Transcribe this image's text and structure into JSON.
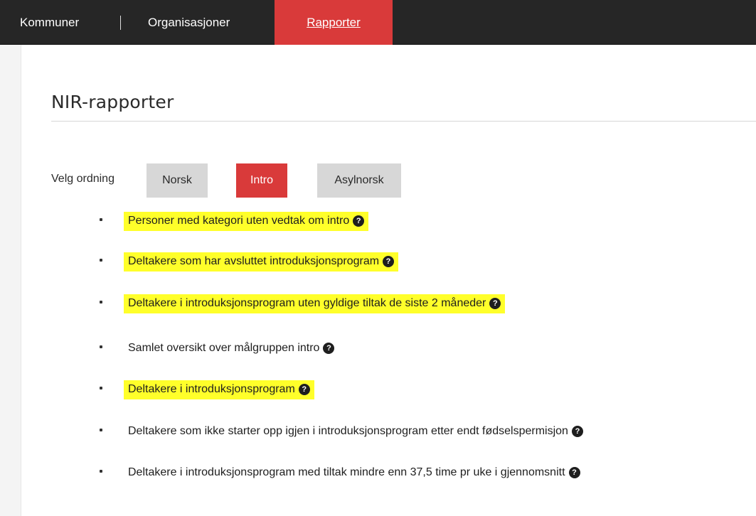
{
  "nav": {
    "items": [
      {
        "label": "Kommuner"
      },
      {
        "label": "Organisasjoner"
      },
      {
        "label": "Rapporter",
        "active": true
      }
    ],
    "active_color": "#d93a3a",
    "background": "#262626"
  },
  "page": {
    "title": "NIR-rapporter"
  },
  "scheme": {
    "label": "Velg ordning",
    "options": [
      {
        "label": "Norsk",
        "selected": false
      },
      {
        "label": "Intro",
        "selected": true
      },
      {
        "label": "Asylnorsk",
        "selected": false
      }
    ]
  },
  "reports": [
    {
      "label": "Personer med kategori uten vedtak om intro",
      "highlighted": true,
      "icon": "question-circle-icon"
    },
    {
      "label": "Deltakere som har avsluttet introduksjonsprogram",
      "highlighted": true,
      "icon": "question-circle-icon"
    },
    {
      "label": "Deltakere i introduksjonsprogram uten gyldige tiltak de siste 2 måneder",
      "highlighted": true,
      "icon": "question-circle-icon"
    },
    {
      "label": "Samlet oversikt over målgruppen intro",
      "highlighted": false,
      "icon": "question-circle-icon"
    },
    {
      "label": "Deltakere i introduksjonsprogram",
      "highlighted": true,
      "icon": "question-circle-icon"
    },
    {
      "label": "Deltakere som ikke starter opp igjen i introduksjonsprogram etter endt fødselspermisjon",
      "highlighted": false,
      "icon": "question-circle-icon"
    },
    {
      "label": "Deltakere i introduksjonsprogram med tiltak mindre enn 37,5 time pr uke i gjennomsnitt",
      "highlighted": false,
      "icon": "question-circle-icon"
    }
  ],
  "colors": {
    "highlight": "#ffff2a",
    "accent": "#d93a3a",
    "button_inactive": "#d7d7d7"
  }
}
